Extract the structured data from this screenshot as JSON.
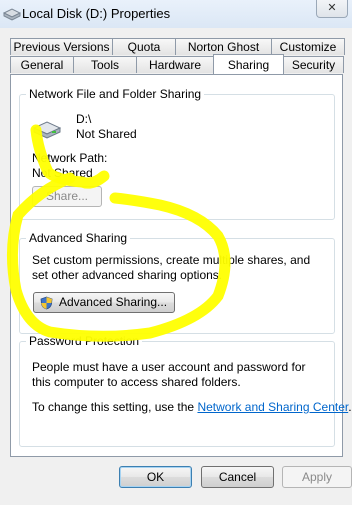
{
  "window": {
    "title": "Local Disk (D:) Properties",
    "close_glyph": "✕"
  },
  "tabs": {
    "row_back": [
      "Previous Versions",
      "Quota",
      "Norton Ghost",
      "Customize"
    ],
    "row_front": [
      "General",
      "Tools",
      "Hardware",
      "Sharing",
      "Security"
    ],
    "selected": "Sharing"
  },
  "network_sharing": {
    "group_title": "Network File and Folder Sharing",
    "drive_path": "D:\\",
    "status": "Not Shared",
    "network_path_label": "Network Path:",
    "network_path_value": "Not Shared",
    "share_button": "Share..."
  },
  "advanced_sharing": {
    "group_title": "Advanced Sharing",
    "description": "Set custom permissions, create multiple shares, and set other advanced sharing options.",
    "button": "Advanced Sharing..."
  },
  "password_protection": {
    "group_title": "Password Protection",
    "description": "People must have a user account and password for this computer to access shared folders.",
    "change_prefix": "To change this setting, use the",
    "link": "Network and Sharing Center",
    "change_suffix": "."
  },
  "footer": {
    "ok": "OK",
    "cancel": "Cancel",
    "apply": "Apply"
  },
  "colors": {
    "highlight": "#ffff00",
    "link": "#0066cc"
  }
}
